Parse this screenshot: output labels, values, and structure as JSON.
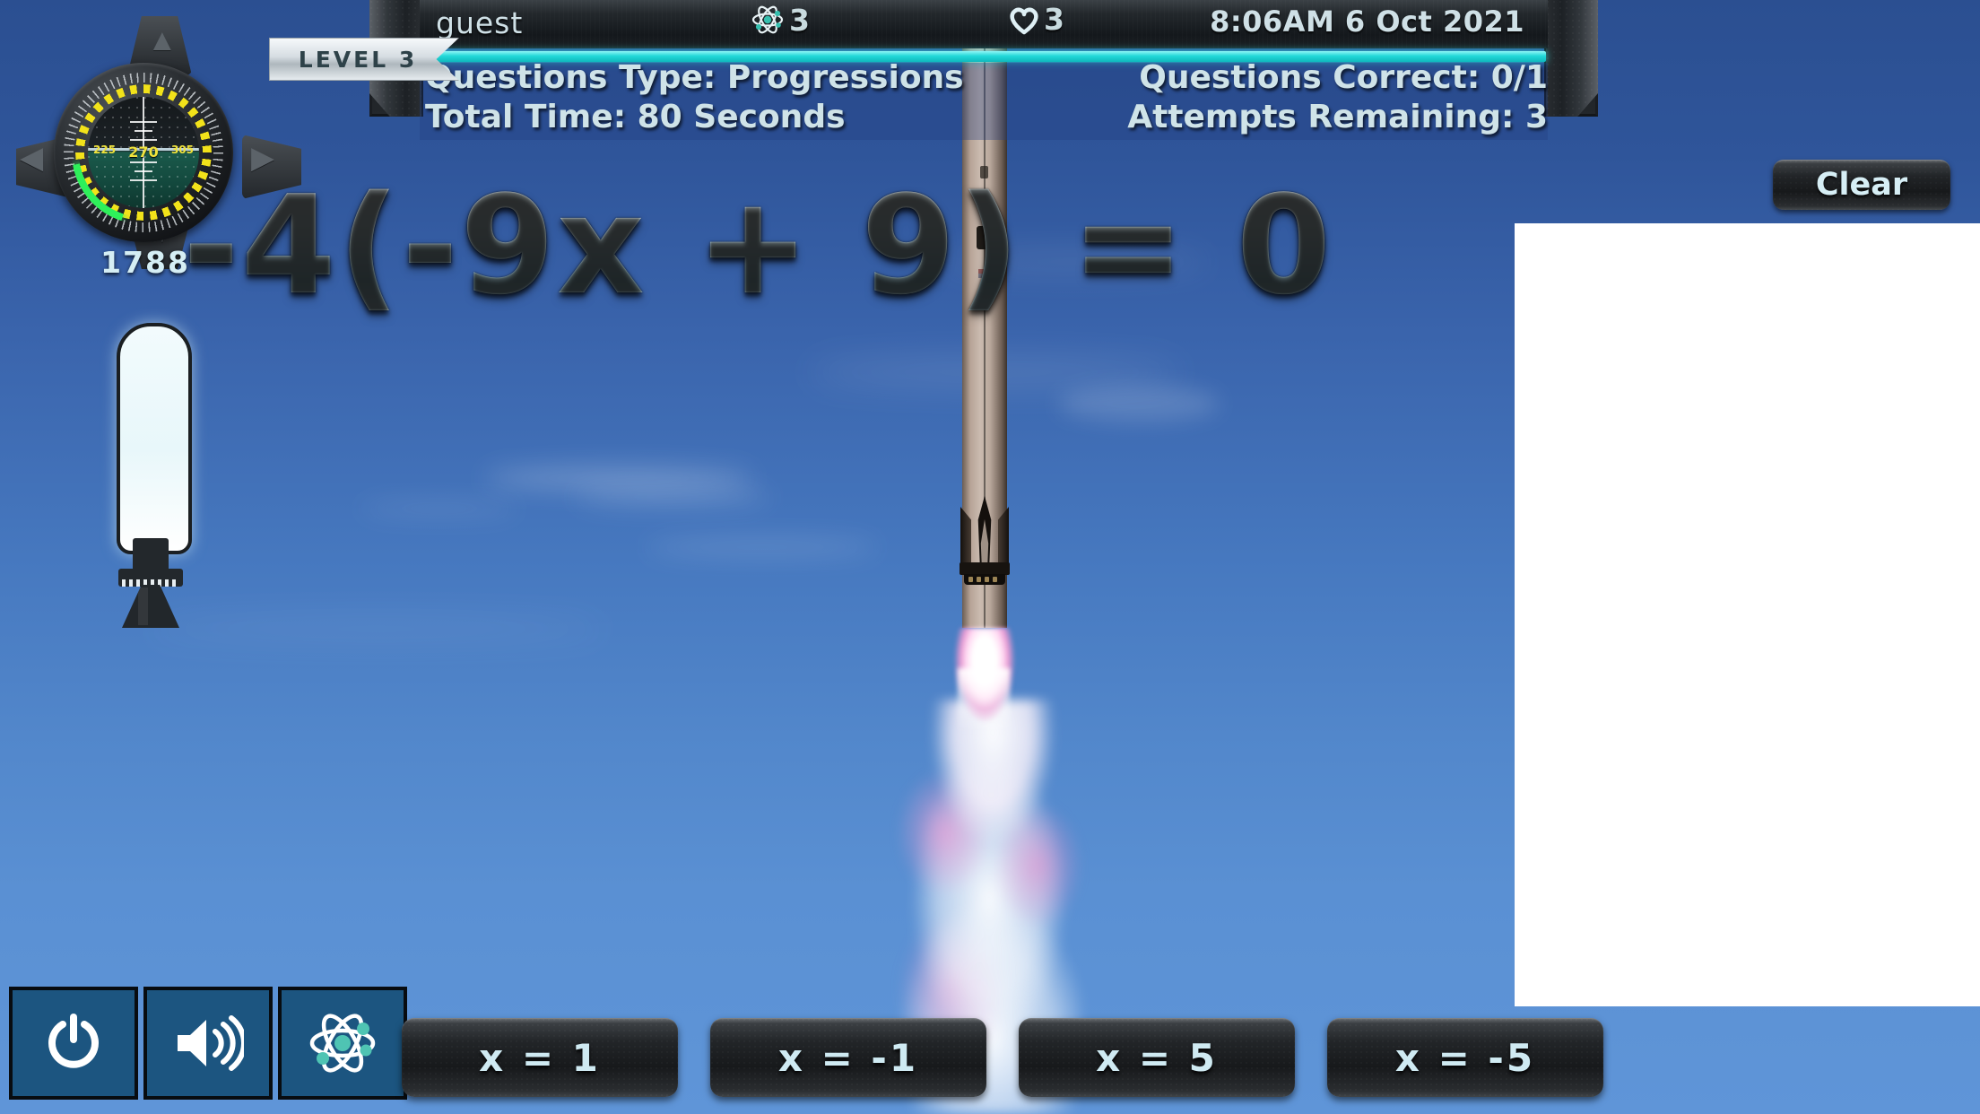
{
  "hud": {
    "username": "guest",
    "atom_icon": "atom-icon",
    "atom_count": "3",
    "heart_icon": "heart-icon",
    "lives_count": "3",
    "clock": "8:06AM  6 Oct 2021",
    "level_badge": "LEVEL 3",
    "progress_percent": 100,
    "progress_color": "#22d8d8",
    "stats": {
      "questions_type": "Questions Type: Progressions",
      "questions_correct": "Questions Correct: 0/1",
      "total_time": "Total Time: 80 Seconds",
      "attempts_remaining": "Attempts Remaining: 3"
    }
  },
  "question": {
    "equation": "-4(-9x + 9) = 0"
  },
  "gauge": {
    "name": "attitude-indicator",
    "heading": "270",
    "heading_left": "225",
    "heading_right": "305",
    "readout": "1788",
    "arc_color": "#2ef05a",
    "dial_color": "#f2e21a"
  },
  "fuel": {
    "name": "fuel-tank-gauge",
    "level_percent": 100,
    "fill_color": "#eef9fb"
  },
  "toolbar": {
    "items": [
      {
        "name": "power-button",
        "icon": "power-icon"
      },
      {
        "name": "volume-button",
        "icon": "volume-icon"
      },
      {
        "name": "atom-button",
        "icon": "atom-icon"
      }
    ]
  },
  "answers": [
    {
      "label": "x = 1"
    },
    {
      "label": "x = -1"
    },
    {
      "label": "x = 5"
    },
    {
      "label": "x = -5"
    }
  ],
  "sidepanel": {
    "clear_label": "Clear",
    "scratchpad_content": ""
  },
  "colors": {
    "sky_top": "#2b4f91",
    "sky_bottom": "#5f95d8",
    "accent_cyan": "#22d8d8",
    "text_light": "#cfe3e8",
    "panel_dark": "#1c2024"
  }
}
